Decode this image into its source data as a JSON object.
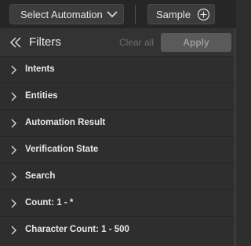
{
  "toolbar": {
    "select_automation_label": "Select Automation",
    "sample_label": "Sample"
  },
  "filters": {
    "title": "Filters",
    "clear_all_label": "Clear all",
    "apply_label": "Apply",
    "items": [
      {
        "label": "Intents"
      },
      {
        "label": "Entities"
      },
      {
        "label": "Automation Result"
      },
      {
        "label": "Verification State"
      },
      {
        "label": "Search"
      },
      {
        "label": "Count:  1 - *"
      },
      {
        "label": "Character Count:  1 - 500"
      }
    ]
  },
  "colors": {
    "background": "#2e2e2e",
    "topbar": "#262626",
    "apply_disabled": "#5a5a5a"
  }
}
